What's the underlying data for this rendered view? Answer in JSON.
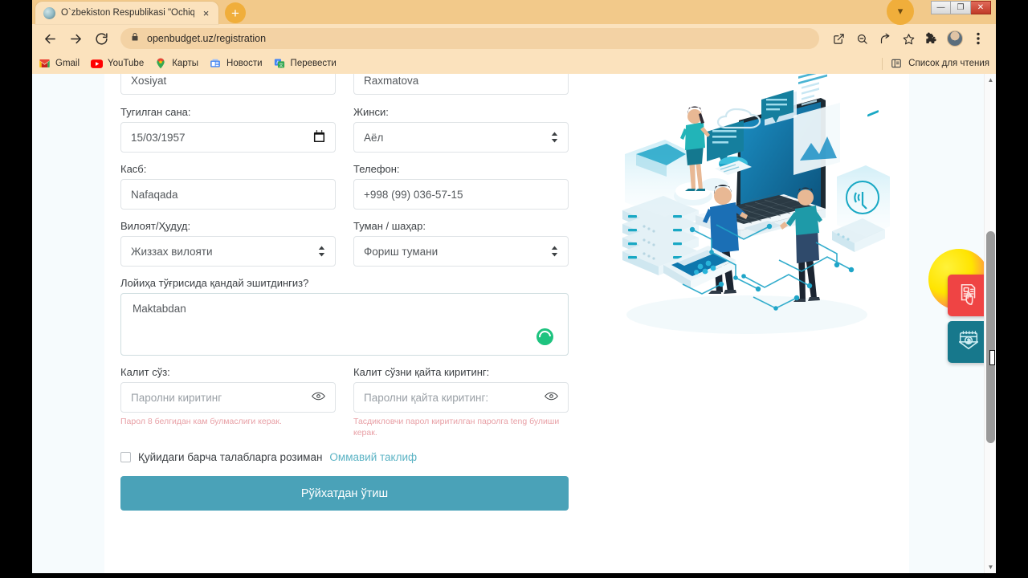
{
  "browser": {
    "tab": {
      "title": "O`zbekiston Respublikasi \"Ochiq",
      "favicon": "globe-icon",
      "close": "×"
    },
    "new_tab_label": "+",
    "window_controls": {
      "minimize": "—",
      "restore": "❐",
      "close": "✕",
      "chevron": "▾"
    },
    "nav": {
      "back": "←",
      "forward": "→",
      "reload": "⟳"
    },
    "omnibox": {
      "lock": "lock-icon",
      "url": "openbudget.uz/registration"
    },
    "toolbar_right": [
      "popup-icon",
      "zoom-out-icon",
      "share-icon",
      "bookmark-star-icon",
      "extensions-icon",
      "profile-avatar",
      "menu-icon"
    ],
    "bookmarks": [
      {
        "label": "Gmail",
        "icon": "gmail-icon"
      },
      {
        "label": "YouTube",
        "icon": "youtube-icon"
      },
      {
        "label": "Карты",
        "icon": "maps-icon"
      },
      {
        "label": "Новости",
        "icon": "news-icon"
      },
      {
        "label": "Перевести",
        "icon": "translate-icon"
      }
    ],
    "reading_list": {
      "label": "Список для чтения",
      "icon": "reading-list-icon"
    }
  },
  "form": {
    "firstname": {
      "value": "Xosiyat"
    },
    "lastname": {
      "value": "Raxmatova"
    },
    "birthdate": {
      "label": "Тугилган сана:",
      "value": "15/03/1957",
      "icon": "calendar-icon"
    },
    "gender": {
      "label": "Жинси:",
      "value": "Аёл"
    },
    "profession": {
      "label": "Касб:",
      "value": "Nafaqada"
    },
    "phone": {
      "label": "Телефон:",
      "value": "+998 (99) 036-57-15"
    },
    "region": {
      "label": "Вилоят/Ҳудуд:",
      "value": "Жиззах вилояти"
    },
    "district": {
      "label": "Туман / шаҳар:",
      "value": "Фориш тумани"
    },
    "source": {
      "label": "Лойиҳа тўғрисида қандай эшитдингиз?",
      "value": "Maktabdan",
      "spinner": "loading-spinner-icon"
    },
    "password": {
      "label": "Калит сўз:",
      "placeholder": "Паролни киритинг",
      "error": "Парол 8 белгидан кам булмаслиги керак.",
      "icon": "eye-icon"
    },
    "password_confirm": {
      "label": "Калит сўзни қайта киритинг:",
      "placeholder": "Паролни қайта киритинг:",
      "error": "Тасдикловчи парол киритилган паролга teng булиши керак.",
      "icon": "eye-icon"
    },
    "agreement": {
      "text": "Қуйидаги барча талабларга розиман",
      "link": "Оммавий таклиф",
      "checked": false
    },
    "submit_label": "Рўйхатдан ўтиш"
  },
  "illustration": {
    "name": "isometric-digital-technology-illustration"
  },
  "side_widgets": [
    {
      "name": "petition-widget",
      "icon": "document-hand-icon",
      "color": "#ef4444"
    },
    {
      "name": "budget-widget",
      "icon": "calendar-money-icon",
      "color": "#17788c"
    }
  ],
  "colors": {
    "accent": "#4aa2b8",
    "link": "#5bb3c4",
    "error": "#e8a0a6",
    "spinner": "#1ec37f",
    "browser_chrome": "#fbe2bd"
  }
}
